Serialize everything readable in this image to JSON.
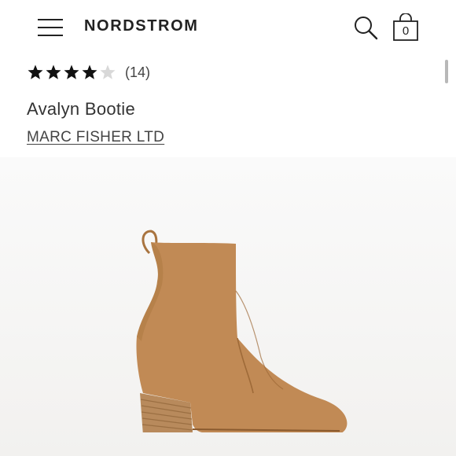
{
  "header": {
    "logo": "NORDSTROM",
    "menu_icon": "hamburger-menu-icon",
    "search_icon": "search-icon",
    "bag_icon": "shopping-bag-icon",
    "bag_count": "0"
  },
  "product": {
    "rating": 4,
    "rating_max": 5,
    "review_count": "(14)",
    "title": "Avalyn Bootie",
    "brand": "MARC FISHER LTD",
    "image": "tan-suede-ankle-boot"
  },
  "colors": {
    "suede": "#c18a55",
    "heel": "#b88a5c",
    "star_filled": "#111111",
    "star_empty": "#d8d8d8"
  }
}
